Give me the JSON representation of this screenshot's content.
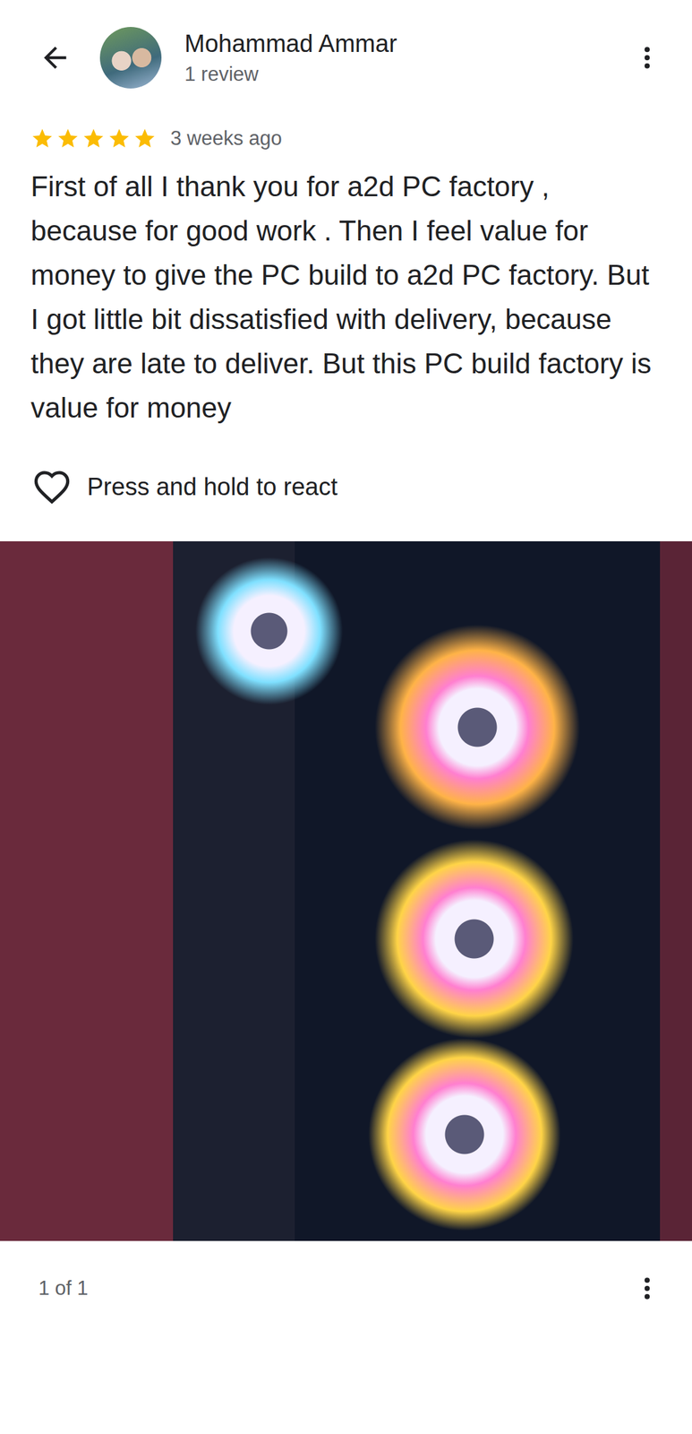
{
  "header": {
    "name": "Mohammad Ammar",
    "review_count": "1 review"
  },
  "review": {
    "stars": 5,
    "time": "3 weeks ago",
    "text": "First of all I thank you for a2d PC factory , because for good work . Then I feel value for money to give the PC build to a2d PC factory. But I got little bit dissatisfied with delivery, because they are late to deliver. But this PC build factory is value for money"
  },
  "react": {
    "label": "Press and hold to react"
  },
  "photo": {
    "counter": "1 of 1"
  }
}
